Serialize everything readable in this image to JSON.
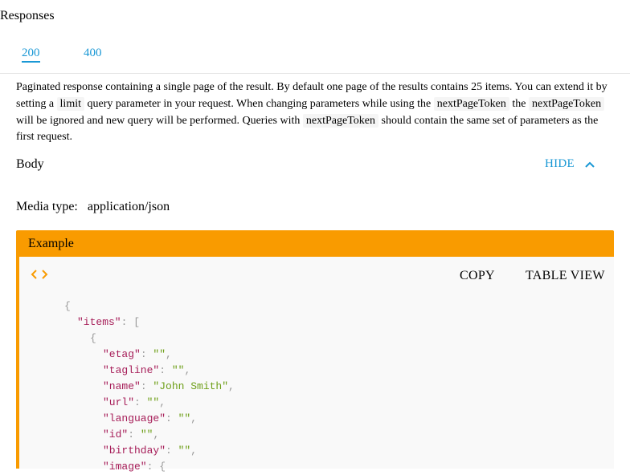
{
  "section_title": "Responses",
  "tabs": [
    {
      "label": "200",
      "active": true
    },
    {
      "label": "400",
      "active": false
    }
  ],
  "description": {
    "part1": "Paginated response containing a single page of the result. By default one page of the results contains 25 items. You can extend it by setting a ",
    "code1": "limit",
    "part2": " query parameter in your request. When changing parameters while using the ",
    "code2": "nextPageToken",
    "part3": " the ",
    "code3": "nextPageToken",
    "part4": " will be ignored and new query will be performed. Queries with ",
    "code4": "nextPageToken",
    "part5": " should contain the same set of parameters as the first request."
  },
  "body": {
    "label": "Body",
    "toggle_label": "HIDE",
    "toggle_icon": "chevron-up-icon"
  },
  "media": {
    "label": "Media type:",
    "value": "application/json"
  },
  "example": {
    "title": "Example",
    "code_icon": "code-icon",
    "copy_label": "COPY",
    "table_view_label": "TABLE VIEW",
    "lines": [
      {
        "type": "open-brace",
        "text": "{"
      },
      {
        "type": "array-key",
        "key": "\"items\"",
        "sep": ": ",
        "rest": "["
      },
      {
        "type": "open-brace",
        "text": "{"
      },
      {
        "type": "pair",
        "key": "\"etag\"",
        "sep": ": ",
        "val": "\"\"",
        "tail": ","
      },
      {
        "type": "pair",
        "key": "\"tagline\"",
        "sep": ": ",
        "val": "\"\"",
        "tail": ","
      },
      {
        "type": "pair",
        "key": "\"name\"",
        "sep": ": ",
        "val": "\"John Smith\"",
        "tail": ","
      },
      {
        "type": "pair",
        "key": "\"url\"",
        "sep": ": ",
        "val": "\"\"",
        "tail": ","
      },
      {
        "type": "pair",
        "key": "\"language\"",
        "sep": ": ",
        "val": "\"\"",
        "tail": ","
      },
      {
        "type": "pair",
        "key": "\"id\"",
        "sep": ": ",
        "val": "\"\"",
        "tail": ","
      },
      {
        "type": "pair",
        "key": "\"birthday\"",
        "sep": ": ",
        "val": "\"\"",
        "tail": ","
      },
      {
        "type": "array-key",
        "key": "\"image\"",
        "sep": ": ",
        "rest": "{"
      }
    ]
  }
}
